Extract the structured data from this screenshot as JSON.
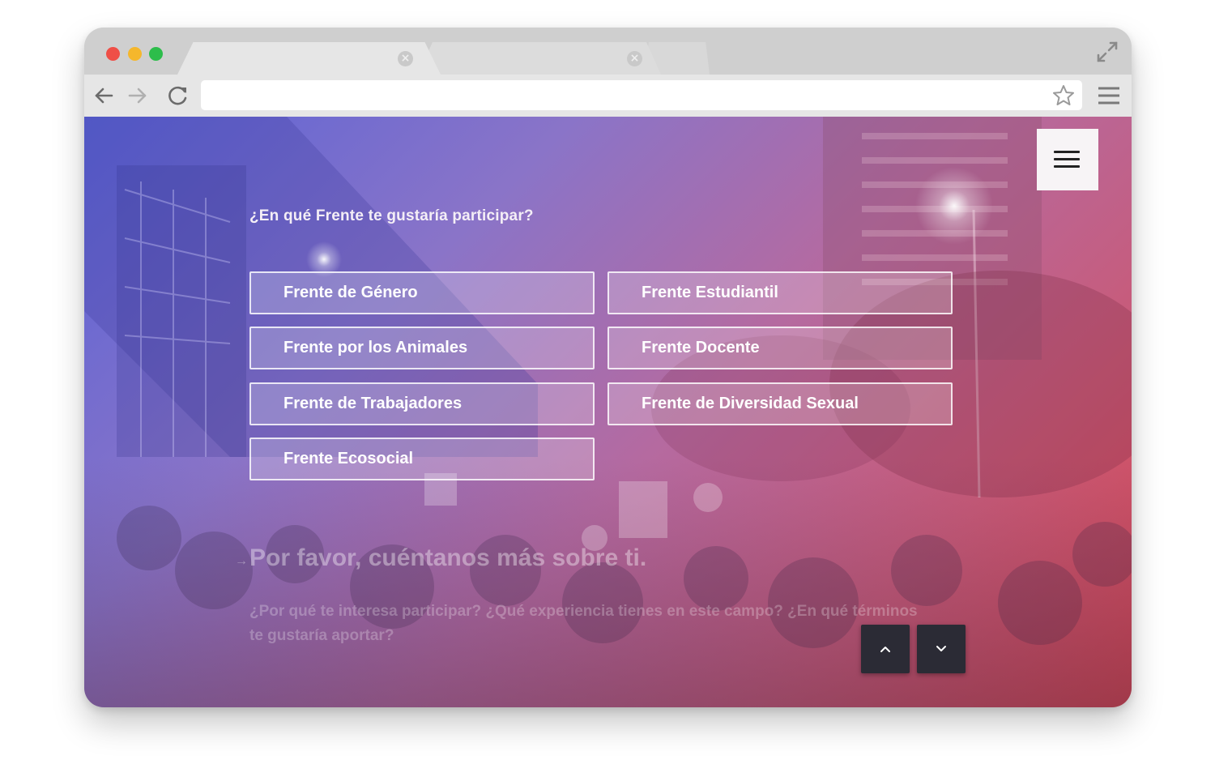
{
  "browser": {
    "tabs": [
      {
        "label": "",
        "active": true
      },
      {
        "label": "",
        "active": false
      }
    ],
    "address": "",
    "icons": {
      "back": "arrow-left-icon",
      "forward": "arrow-right-icon",
      "reload": "reload-icon",
      "bookmark": "star-icon",
      "menu": "menu-icon",
      "fullscreen": "expand-icon",
      "tab_close": "close-icon"
    },
    "tab_close_glyph": "×"
  },
  "page": {
    "question": "¿En qué Frente te gustaría participar?",
    "options": [
      {
        "label": "Frente de Género"
      },
      {
        "label": "Frente Estudiantil"
      },
      {
        "label": "Frente por los Animales"
      },
      {
        "label": "Frente Docente"
      },
      {
        "label": "Frente de Trabajadores"
      },
      {
        "label": "Frente de Diversidad Sexual"
      },
      {
        "label": "Frente Ecosocial"
      }
    ],
    "next_question": {
      "arrow": "→",
      "title": "Por favor, cuéntanos más sobre ti.",
      "description": "¿Por qué te interesa participar? ¿Qué experiencia tienes en este campo? ¿En qué términos te gustaría aportar?"
    },
    "pager": {
      "up_icon": "chevron-up-icon",
      "down_icon": "chevron-down-icon"
    },
    "colors": {
      "gradient_start": "#5963d6",
      "gradient_end": "#d8454e",
      "pager_bg": "#2b2b35"
    }
  }
}
